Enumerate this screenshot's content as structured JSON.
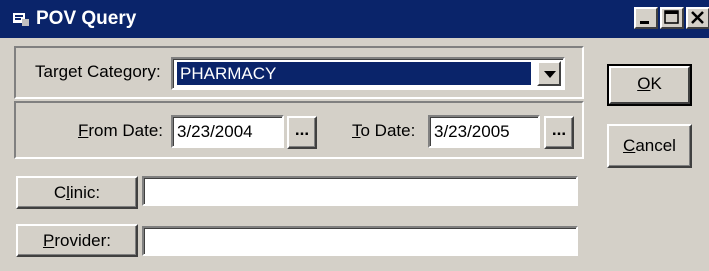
{
  "window": {
    "title": "POV Query",
    "controls": [
      "minimize-icon",
      "maximize-icon",
      "close-icon"
    ]
  },
  "target_category": {
    "label": "Target Category:",
    "value": "PHARMACY"
  },
  "dates": {
    "from_label_key": "F",
    "from_label_rest": "rom Date:",
    "from_value": "3/23/2004",
    "to_label_key": "T",
    "to_label_rest": "o Date:",
    "to_value": "3/23/2005",
    "picker_label": "..."
  },
  "clinic": {
    "button_key": "l",
    "button_pre": "C",
    "button_post": "inic:",
    "value": ""
  },
  "provider": {
    "button_key": "P",
    "button_post": "rovider:",
    "value": ""
  },
  "actions": {
    "ok_key": "O",
    "ok_rest": "K",
    "cancel_key": "C",
    "cancel_rest": "ancel"
  }
}
